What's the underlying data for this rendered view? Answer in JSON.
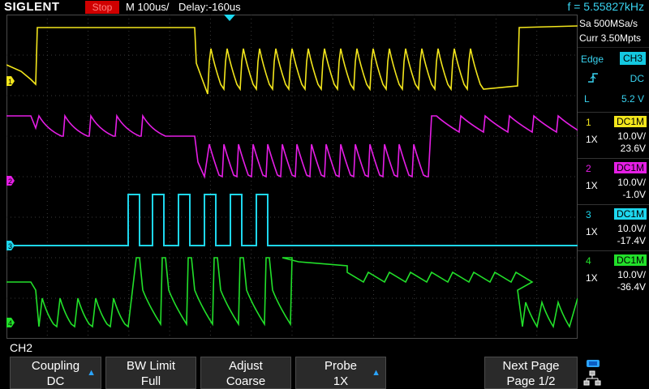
{
  "topbar": {
    "logo": "SIGLENT",
    "run_state": "Stop",
    "timebase": "M 100us/",
    "delay": "Delay:-160us",
    "frequency": "f = 5.55827kHz"
  },
  "acquisition": {
    "sample_rate": "Sa 500MSa/s",
    "memory": "Curr 3.50Mpts"
  },
  "trigger": {
    "type": "Edge",
    "source": "CH3",
    "slope_icon": "rising-edge-icon",
    "coupling": "DC",
    "level_label": "L",
    "level": "5.2 V"
  },
  "channels": [
    {
      "num": "1",
      "coupling": "DC1M",
      "probe": "1X",
      "scale": "10.0V/",
      "offset": "23.6V",
      "color": "#f3e61c"
    },
    {
      "num": "2",
      "coupling": "DC1M",
      "probe": "1X",
      "scale": "10.0V/",
      "offset": "-1.0V",
      "color": "#e51ee5"
    },
    {
      "num": "3",
      "coupling": "DC1M",
      "probe": "1X",
      "scale": "10.0V/",
      "offset": "-17.4V",
      "color": "#1ed7ee"
    },
    {
      "num": "4",
      "coupling": "DC1M",
      "probe": "1X",
      "scale": "10.0V/",
      "offset": "-36.4V",
      "color": "#22e02a"
    }
  ],
  "menu": {
    "title": "CH2",
    "softkeys": [
      {
        "top": "Coupling",
        "bottom": "DC",
        "has_arrow": true
      },
      {
        "top": "BW Limit",
        "bottom": "Full",
        "has_arrow": false
      },
      {
        "top": "Adjust",
        "bottom": "Coarse",
        "has_arrow": false
      },
      {
        "top": "Probe",
        "bottom": "1X",
        "has_arrow": true
      },
      {
        "top": "Next Page",
        "bottom": "Page 1/2",
        "has_arrow": false
      }
    ]
  },
  "colors": {
    "accent": "#1ed7ee",
    "stop_red": "#d00000",
    "grid": "#3a3a3a"
  }
}
